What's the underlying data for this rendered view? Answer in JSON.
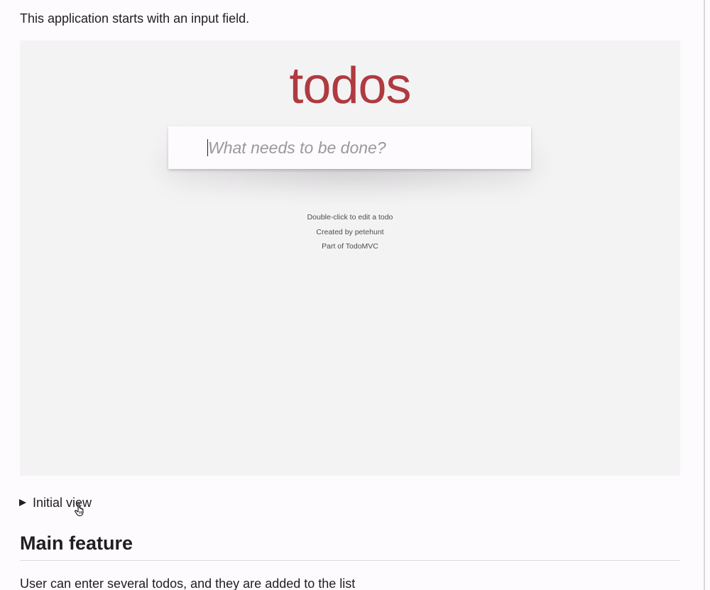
{
  "intro_text": "This application starts with an input field.",
  "demo": {
    "title": "todos",
    "input_placeholder": "What needs to be done?",
    "input_value": "",
    "info": [
      "Double-click to edit a todo",
      "Created by petehunt",
      "Part of TodoMVC"
    ],
    "title_color": "#af3a40",
    "background_color": "#f4f3f4"
  },
  "details": {
    "summary": "Initial view",
    "expanded": false,
    "toggle_icon": "triangle-right-icon"
  },
  "cursor_icon": "hand-pointer-icon",
  "section": {
    "title": "Main feature",
    "text": "User can enter several todos, and they are added to the list"
  }
}
